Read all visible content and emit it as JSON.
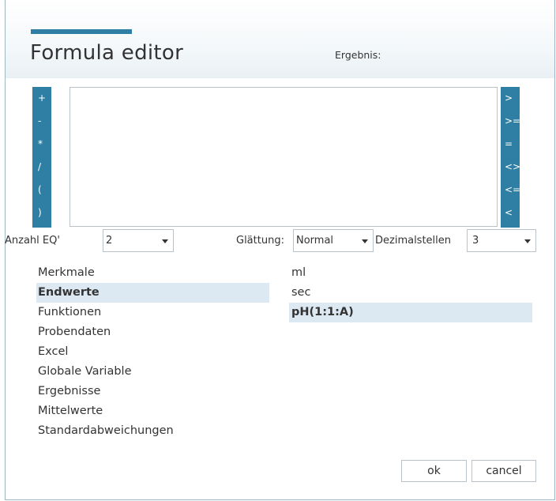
{
  "title": "Formula editor",
  "result_label": "Ergebnis:",
  "operators_left": [
    "+",
    "-",
    "*",
    "/",
    "(",
    ")"
  ],
  "operators_right": [
    ">",
    ">=",
    "=",
    "<>",
    "<=",
    "<"
  ],
  "formula": {
    "value": ""
  },
  "options": {
    "anzahl_label": "Anzahl EQ'",
    "anzahl_value": "2",
    "glaettung_label": "Glättung:",
    "glaettung_value": "Normal",
    "dezimal_label": "Dezimalstellen",
    "dezimal_value": "3"
  },
  "categories": [
    "Merkmale",
    "Endwerte",
    "Funktionen",
    "Probendaten",
    "Excel",
    "Globale Variable",
    "Ergebnisse",
    "Mittelwerte",
    "Standardabweichungen"
  ],
  "selected_category": "Endwerte",
  "values": [
    "ml",
    "sec",
    "pH(1:1:A)"
  ],
  "selected_value": "pH(1:1:A)",
  "buttons": {
    "ok": "ok",
    "cancel": "cancel"
  },
  "colors": {
    "accent": "#2e7fa3",
    "selection": "#dce9f3"
  }
}
